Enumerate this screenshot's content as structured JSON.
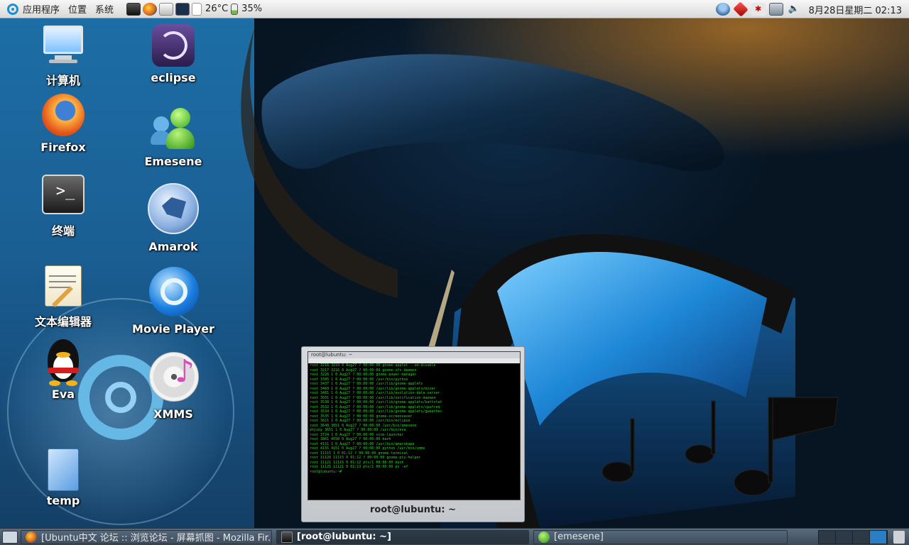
{
  "top_panel": {
    "menus": [
      "应用程序",
      "位置",
      "系统"
    ],
    "weather": "26°C",
    "battery": "35%",
    "clock": "8月28日星期二 02:13"
  },
  "desktop_icons": {
    "computer": "计算机",
    "firefox": "Firefox",
    "terminal": "终端",
    "text_editor": "文本编辑器",
    "eva": "Eva",
    "temp": "temp",
    "eclipse": "eclipse",
    "emesene": "Emesene",
    "amarok": "Amarok",
    "movie_player": "Movie Player",
    "xmms": "XMMS"
  },
  "terminal_preview": {
    "window_title": "root@lubuntu: ~",
    "caption": "root@lubuntu: ~",
    "lines": [
      "root      3216  3210   0 Aug27 ?        00:00:00 gnome-applet --sm-disable",
      "root      3217  3216   0 Aug27 ?        00:00:00 gnome-vfs-daemon",
      "root      3220     1   0 Aug27 ?        00:00:00 gnome-power-manager",
      "root      3395     1   0 Aug27 ?        00:00:00 /usr/bin/python",
      "root      3437     1   0 Aug27 ?        00:00:00 /usr/lib/gnome-applets",
      "root      3460     1   0 Aug27 ?        00:00:00 /usr/lib/gnome-applets/mixer",
      "root      3481     1   0 Aug27 ?        00:00:00 /usr/lib/evolution-data-server",
      "root      3501     1   0 Aug27 ?        00:00:00 /usr/lib/notification-daemon",
      "root      3530     1   0 Aug27 ?        00:00:00 /usr/lib/gnome-applets/battstat",
      "root      3532     1   0 Aug27 ?        00:00:00 /usr/lib/gnome-applets/cpufreq",
      "root      3534     1   0 Aug27 ?        00:00:00 /usr/lib/gnome-applets/gweather",
      "root      3535     1   0 Aug27 ?        00:00:00 gnome-screensaver",
      "root      3621     1   0 Aug27 ?        00:00:00 /usr/bin/eclipse",
      "root      3648  3651   0 Aug27 ?        00:00:00 /usr/bin/emesene",
      "zhjuny    3651     1   0 Aug27 ?        00:00:00 /usr/bin/eva",
      "root      3724     1   0 Aug27 ?        00:00:00 scim-launcher",
      "root      3881  4558   0 Aug27 ?        00:00:00 bash",
      "root      4151     1   0 Aug27 ?        00:00:00 /usr/bin/amarokapp",
      "root      4155  4151   0 Aug27 ?        00:00:00 python /usr/bin/xmms",
      "root     11115     1   0 01:12 ?        00:00:00 gnome-terminal",
      "root     11120 11115   0 01:12 ?        00:00:00 gnome-pty-helper",
      "root     11121 11115   0 01:12 pts/1    00:00:00 bash",
      "root     11125 11121   0 02:13 pts/1    00:00:00 ps -ef",
      "root@lubuntu:~# "
    ]
  },
  "taskbar": {
    "tasks": [
      {
        "label": "[Ubuntu中文 论坛 :: 浏览论坛 - 屏幕抓图 - Mozilla Fir...",
        "active": false
      },
      {
        "label": "[root@lubuntu: ~]",
        "active": true
      },
      {
        "label": "[emesene]",
        "active": false
      }
    ]
  },
  "colors": {
    "accent": "#1e8fd0",
    "terminal_text": "#2bd42b",
    "panel_bottom": "#3b4a59"
  }
}
